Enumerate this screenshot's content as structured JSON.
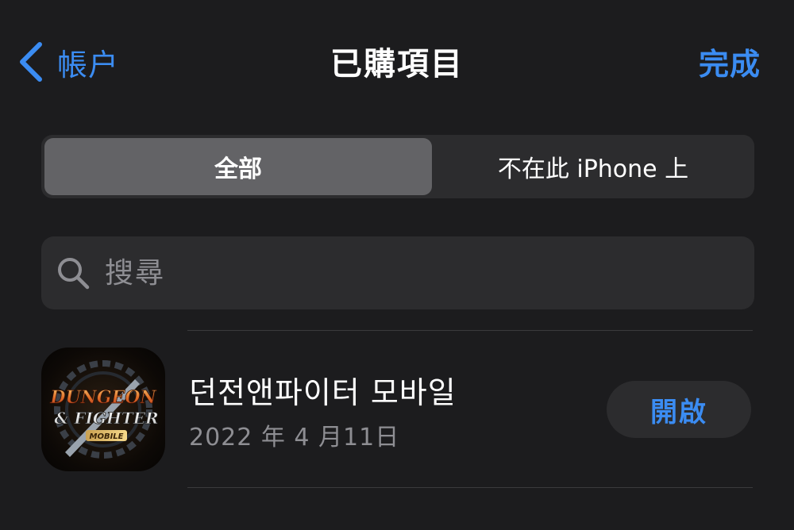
{
  "nav": {
    "back_label": "帳户",
    "title": "已購項目",
    "done_label": "完成"
  },
  "segments": [
    {
      "label": "全部",
      "selected": true
    },
    {
      "label": "不在此 iPhone 上",
      "selected": false
    }
  ],
  "search": {
    "placeholder": "搜尋",
    "value": ""
  },
  "purchases": [
    {
      "name": "던전앤파이터 모바일",
      "date": "2022 年 4 月11日",
      "action_label": "開啟",
      "icon": "dungeon-fighter-mobile-app-icon",
      "icon_logo": {
        "line1": "DUNGEON",
        "line2": "& FIGHTER",
        "line3": "MOBILE"
      }
    }
  ],
  "colors": {
    "background": "#1c1c1e",
    "accent": "#3b8cf2",
    "secondary_text": "#8e8e93",
    "control_fill": "#2c2c2e",
    "segment_selected": "#636366"
  }
}
